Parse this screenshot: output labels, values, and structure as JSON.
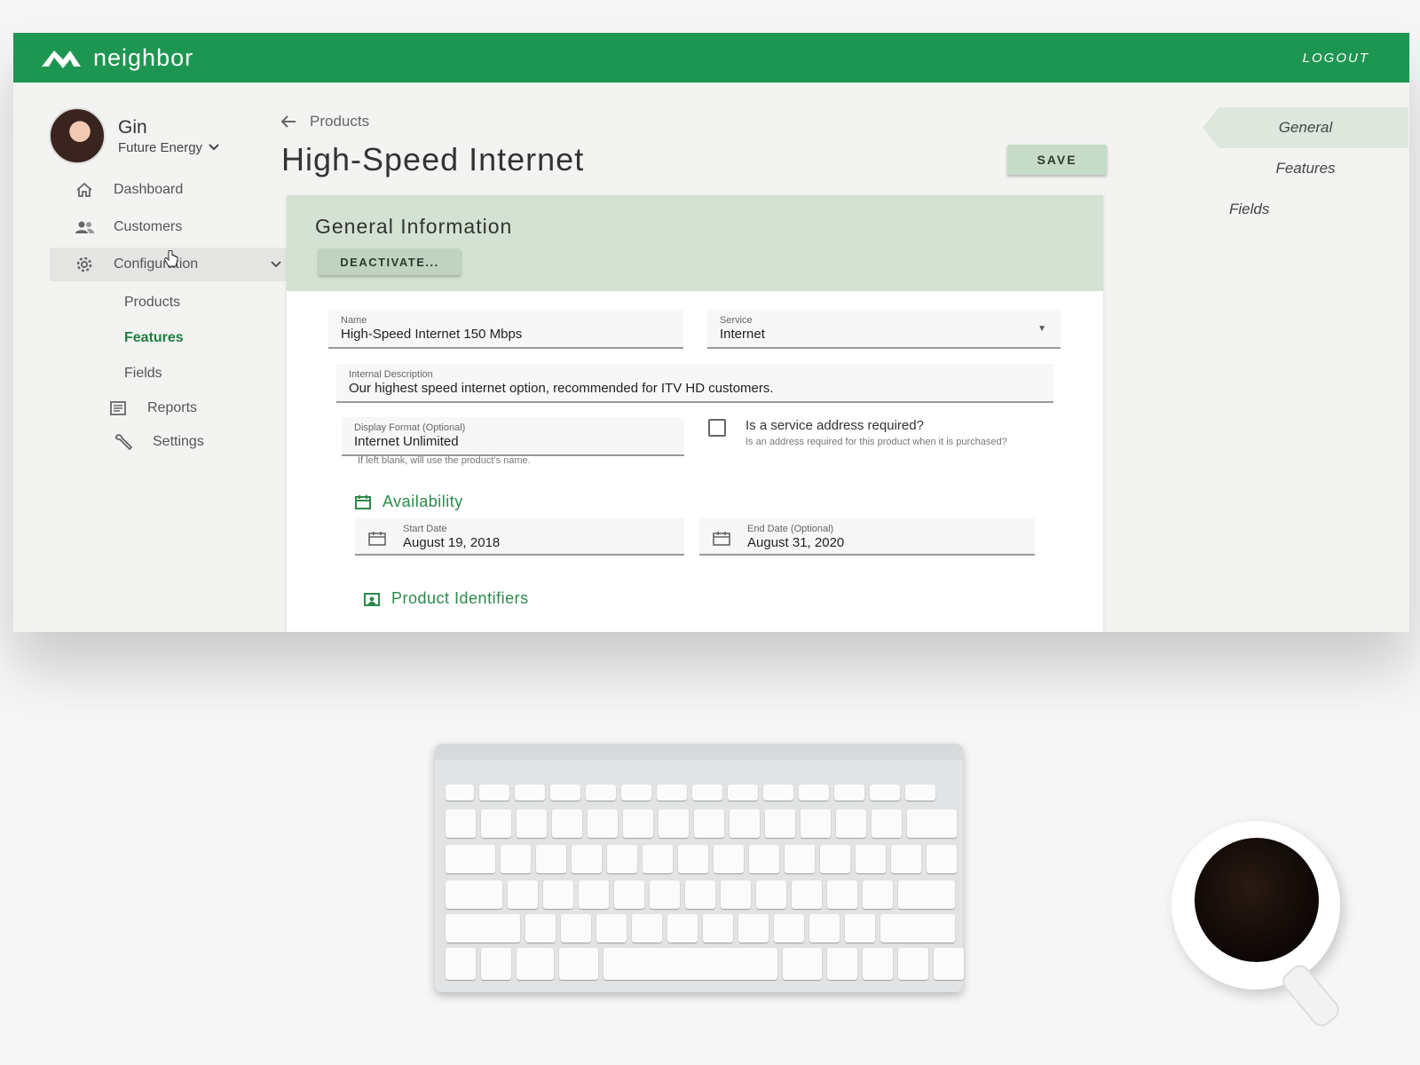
{
  "app": {
    "brand": "neighbor",
    "logout_label": "LOGOUT"
  },
  "user": {
    "name": "Gin",
    "org": "Future Energy"
  },
  "sidebar": {
    "items": [
      {
        "label": "Dashboard",
        "icon": "home-icon"
      },
      {
        "label": "Customers",
        "icon": "users-icon"
      },
      {
        "label": "Configuration",
        "icon": "gear-icon"
      },
      {
        "label": "Reports",
        "icon": "report-icon"
      },
      {
        "label": "Settings",
        "icon": "wrench-icon"
      }
    ],
    "config_sub": [
      {
        "label": "Products"
      },
      {
        "label": "Features",
        "active": true
      },
      {
        "label": "Fields"
      }
    ]
  },
  "main": {
    "breadcrumb": "Products",
    "title": "High-Speed Internet",
    "save_label": "SAVE",
    "section_title": "General Information",
    "deactivate_label": "DEACTIVATE...",
    "name": {
      "label": "Name",
      "value": "High-Speed Internet 150 Mbps"
    },
    "service": {
      "label": "Service",
      "value": "Internet"
    },
    "internal_description": {
      "label": "Internal Description",
      "value": "Our highest speed internet option, recommended for ITV HD customers."
    },
    "display_format": {
      "label": "Display Format (Optional)",
      "value": "Internet Unlimited",
      "hint": "If left blank, will use the product's name."
    },
    "service_address": {
      "question": "Is a service address required?",
      "help": "Is an address required for this product when it is purchased?",
      "checked": false
    },
    "availability": {
      "heading": "Availability",
      "start": {
        "label": "Start Date",
        "value": "August 19, 2018"
      },
      "end": {
        "label": "End Date (Optional)",
        "value": "August 31, 2020"
      }
    },
    "identifiers_heading": "Product Identifiers"
  },
  "right_nav": [
    {
      "label": "General",
      "active": true
    },
    {
      "label": "Features"
    },
    {
      "label": "Fields"
    }
  ],
  "colors": {
    "brand": "#1d9651",
    "accent_text": "#2a8a4a",
    "active_nav": "#1b7f3f",
    "section_bg": "#d3e2d3"
  }
}
